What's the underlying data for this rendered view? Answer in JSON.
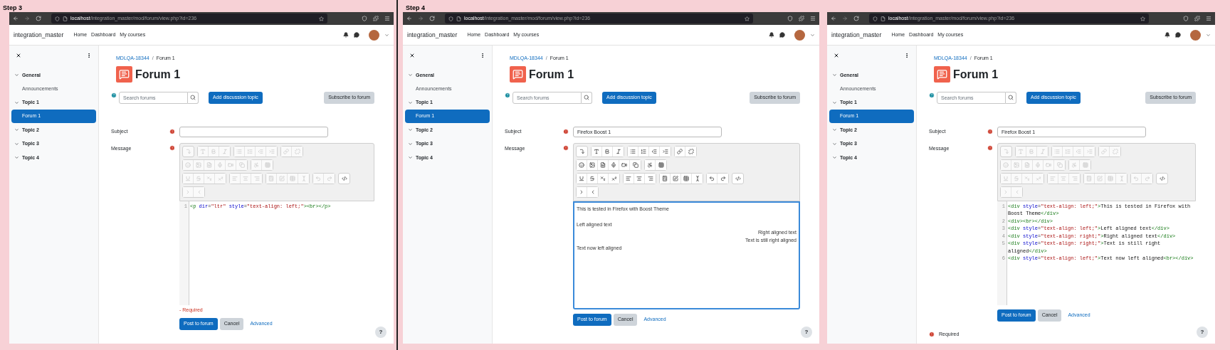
{
  "panels": [
    {
      "step_label": "Step 3",
      "browser": {
        "url_host": "localhost",
        "url_path": "/integration_master/mod/forum/view.php?id=236"
      },
      "site_name": "integration_master",
      "nav": [
        "Home",
        "Dashboard",
        "My courses"
      ],
      "sidebar": [
        {
          "label": "General",
          "expanded": true,
          "children": [
            {
              "label": "Announcements",
              "selected": false
            }
          ]
        },
        {
          "label": "Topic 1",
          "expanded": true,
          "children": [
            {
              "label": "Forum 1",
              "selected": true
            }
          ]
        },
        {
          "label": "Topic 2",
          "expanded": true
        },
        {
          "label": "Topic 3",
          "expanded": true
        },
        {
          "label": "Topic 4",
          "expanded": true
        }
      ],
      "breadcrumb": [
        {
          "label": "MDLQA-18344",
          "link": true
        },
        {
          "label": "Forum 1",
          "link": false
        }
      ],
      "breadcrumb_separator": "/",
      "title": "Forum 1",
      "search": {
        "placeholder": "Search forums"
      },
      "actions": [
        {
          "label": "Add discussion topic",
          "kind": "primary"
        },
        {
          "label": "Subscribe to forum",
          "kind": "secondary"
        }
      ],
      "subject": {
        "label": "Subject",
        "required": true
      },
      "message": {
        "label": "Message",
        "required": true
      },
      "editor": {
        "kind": "source",
        "toolbar_disabled": true,
        "focused": false,
        "lines": [
          {
            "number": "1",
            "tokens": [
              {
                "kind": "tag",
                "text": "<p"
              },
              {
                "kind": "attr",
                "text": " dir"
              },
              {
                "kind": "punct",
                "text": "="
              },
              {
                "kind": "string",
                "text": "\"ltr\""
              },
              {
                "kind": "attr",
                "text": " style"
              },
              {
                "kind": "punct",
                "text": "="
              },
              {
                "kind": "string",
                "text": "\"text-align: left;\""
              },
              {
                "kind": "tag",
                "text": "><br></p>"
              }
            ]
          }
        ]
      },
      "required_note": {
        "kind": "inline",
        "text": "- Required"
      },
      "form_buttons": [
        {
          "label": "Post to forum",
          "kind": "primary"
        },
        {
          "label": "Cancel",
          "kind": "secondary"
        },
        {
          "label": "Advanced",
          "kind": "link"
        }
      ],
      "help_label": "?"
    },
    {
      "step_label": "Step 4",
      "browser": {
        "url_host": "localhost",
        "url_path": "/integration_master/mod/forum/view.php?id=236"
      },
      "site_name": "integration_master",
      "nav": [
        "Home",
        "Dashboard",
        "My courses"
      ],
      "sidebar": [
        {
          "label": "General",
          "expanded": true,
          "children": [
            {
              "label": "Announcements",
              "selected": false
            }
          ]
        },
        {
          "label": "Topic 1",
          "expanded": true,
          "children": [
            {
              "label": "Forum 1",
              "selected": true
            }
          ]
        },
        {
          "label": "Topic 2",
          "expanded": true
        },
        {
          "label": "Topic 3",
          "expanded": true
        },
        {
          "label": "Topic 4",
          "expanded": true
        }
      ],
      "breadcrumb": [
        {
          "label": "MDLQA-18344",
          "link": true
        },
        {
          "label": "Forum 1",
          "link": false
        }
      ],
      "breadcrumb_separator": "/",
      "title": "Forum 1",
      "search": {
        "placeholder": "Search forums"
      },
      "actions": [
        {
          "label": "Add discussion topic",
          "kind": "primary"
        },
        {
          "label": "Subscribe to forum",
          "kind": "secondary"
        }
      ],
      "subject": {
        "label": "Subject",
        "required": true,
        "value": "Firefox Boost 1"
      },
      "message": {
        "label": "Message",
        "required": true
      },
      "editor": {
        "kind": "rich",
        "toolbar_disabled": false,
        "focused": true,
        "lines": [
          {
            "kind": "text",
            "right_aligned": false,
            "text": "This is tested in Firefox with Boost Theme"
          },
          {
            "kind": "blank"
          },
          {
            "kind": "text",
            "right_aligned": false,
            "text": "Left aligned text"
          },
          {
            "kind": "text",
            "right_aligned": true,
            "text": "Right aligned text"
          },
          {
            "kind": "text",
            "right_aligned": true,
            "text": "Text is still right aligned"
          },
          {
            "kind": "text",
            "right_aligned": false,
            "text": "Text now left aligned"
          }
        ]
      },
      "form_buttons": [
        {
          "label": "Post to forum",
          "kind": "primary"
        },
        {
          "label": "Cancel",
          "kind": "secondary"
        },
        {
          "label": "Advanced",
          "kind": "link"
        }
      ],
      "help_label": "?"
    },
    {
      "browser": {
        "url_host": "localhost",
        "url_path": "/integration_master/mod/forum/view.php?id=236"
      },
      "site_name": "integration_master",
      "nav": [
        "Home",
        "Dashboard",
        "My courses"
      ],
      "sidebar": [
        {
          "label": "General",
          "expanded": true,
          "children": [
            {
              "label": "Announcements",
              "selected": false
            }
          ]
        },
        {
          "label": "Topic 1",
          "expanded": true,
          "children": [
            {
              "label": "Forum 1",
              "selected": true
            }
          ]
        },
        {
          "label": "Topic 2",
          "expanded": true
        },
        {
          "label": "Topic 3",
          "expanded": true
        },
        {
          "label": "Topic 4",
          "expanded": true
        }
      ],
      "breadcrumb": [
        {
          "label": "MDLQA-18344",
          "link": true
        },
        {
          "label": "Forum 1",
          "link": false
        }
      ],
      "breadcrumb_separator": "/",
      "title": "Forum 1",
      "search": {
        "placeholder": "Search forums"
      },
      "actions": [
        {
          "label": "Add discussion topic",
          "kind": "primary"
        },
        {
          "label": "Subscribe to forum",
          "kind": "secondary"
        }
      ],
      "subject": {
        "label": "Subject",
        "required": true,
        "value": "Firefox Boost 1"
      },
      "message": {
        "label": "Message",
        "required": true
      },
      "editor": {
        "kind": "source",
        "toolbar_disabled": true,
        "focused": false,
        "lines": [
          {
            "number": "1",
            "tokens": [
              {
                "kind": "tag",
                "text": "<div"
              },
              {
                "kind": "attr",
                "text": " style"
              },
              {
                "kind": "punct",
                "text": "="
              },
              {
                "kind": "string",
                "text": "\"text-align: left;\""
              },
              {
                "kind": "tag",
                "text": ">"
              },
              {
                "kind": "text",
                "text": "This is tested in Firefox with Boost Theme"
              },
              {
                "kind": "tag",
                "text": "</div>"
              }
            ]
          },
          {
            "number": "2",
            "tokens": [
              {
                "kind": "tag",
                "text": "<div><br></div>"
              }
            ]
          },
          {
            "number": "3",
            "tokens": [
              {
                "kind": "tag",
                "text": "<div"
              },
              {
                "kind": "attr",
                "text": " style"
              },
              {
                "kind": "punct",
                "text": "="
              },
              {
                "kind": "string",
                "text": "\"text-align: left;\""
              },
              {
                "kind": "tag",
                "text": ">"
              },
              {
                "kind": "text",
                "text": "Left aligned text"
              },
              {
                "kind": "tag",
                "text": "</div>"
              }
            ]
          },
          {
            "number": "4",
            "tokens": [
              {
                "kind": "tag",
                "text": "<div"
              },
              {
                "kind": "attr",
                "text": " style"
              },
              {
                "kind": "punct",
                "text": "="
              },
              {
                "kind": "string",
                "text": "\"text-align: right;\""
              },
              {
                "kind": "tag",
                "text": ">"
              },
              {
                "kind": "text",
                "text": "Right aligned text"
              },
              {
                "kind": "tag",
                "text": "</div>"
              }
            ]
          },
          {
            "number": "5",
            "tokens": [
              {
                "kind": "tag",
                "text": "<div"
              },
              {
                "kind": "attr",
                "text": " style"
              },
              {
                "kind": "punct",
                "text": "="
              },
              {
                "kind": "string",
                "text": "\"text-align: right;\""
              },
              {
                "kind": "tag",
                "text": ">"
              },
              {
                "kind": "text",
                "text": "Text is still right aligned"
              },
              {
                "kind": "tag",
                "text": "</div>"
              }
            ]
          },
          {
            "number": "6",
            "tokens": [
              {
                "kind": "tag",
                "text": "<div"
              },
              {
                "kind": "attr",
                "text": " style"
              },
              {
                "kind": "punct",
                "text": "="
              },
              {
                "kind": "string",
                "text": "\"text-align: left;\""
              },
              {
                "kind": "tag",
                "text": ">"
              },
              {
                "kind": "text",
                "text": "Text now left aligned"
              },
              {
                "kind": "tag",
                "text": "<br></div>"
              }
            ]
          }
        ]
      },
      "required_note": {
        "kind": "footer",
        "text": "Required"
      },
      "form_buttons": [
        {
          "label": "Post to forum",
          "kind": "primary"
        },
        {
          "label": "Cancel",
          "kind": "secondary"
        },
        {
          "label": "Advanced",
          "kind": "link"
        }
      ],
      "help_label": "?"
    }
  ]
}
